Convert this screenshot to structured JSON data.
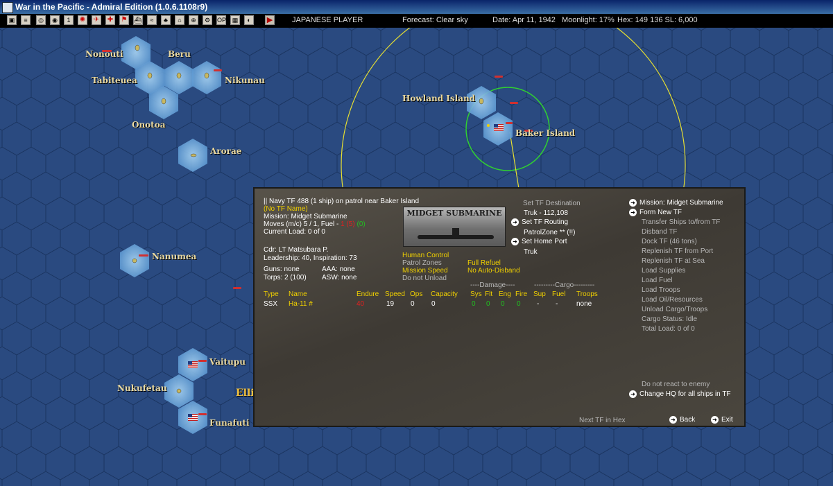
{
  "window": {
    "title": "War in the Pacific - Admiral Edition (1.0.6.1108r9)"
  },
  "toolbar": {
    "player": "JAPANESE PLAYER",
    "forecast": "Forecast: Clear sky",
    "date": "Date: Apr 11, 1942",
    "moonlight": "Moonlight: 17%",
    "hex": "Hex: 149 136  SL: 6,000"
  },
  "map": {
    "labels": {
      "nonouti": "Nonouti",
      "beru": "Beru",
      "tabiteuea": "Tabiteuea",
      "nikunau": "Nikunau",
      "onotoa": "Onotoa",
      "arorae": "Arorae",
      "howland": "Howland Island",
      "baker": "Baker Island",
      "nanumea": "Nanumea",
      "vaitupu": "Vaitupu",
      "nukufetau": "Nukufetau",
      "funafuti": "Funafuti",
      "ellice_partial": "Elli"
    }
  },
  "tf": {
    "header": "|| Navy TF 488 (1 ship)  on patrol near Baker Island",
    "name": "(No TF Name)",
    "mission": "Mission: Midget Submarine",
    "moves_prefix": "Moves (m/c) 5 / 1, Fuel - ",
    "moves_fuel": "1 (5)",
    "moves_fuel2": "(0)",
    "current_load": "Current Load: 0 of 0",
    "commander": "Cdr: LT Matsubara P.",
    "leadership": "Leadership: 40, Inspiration: 73",
    "guns": "Guns: none",
    "aaa": "AAA: none",
    "torps": "Torps: 2 (100)",
    "asw": "ASW: none",
    "photo_caption": "MIDGET SUBMARINE",
    "opt1": "Human Control",
    "opt2": "Patrol Zones",
    "opt3": "Mission Speed",
    "opt4": "Do not Unload",
    "opt5": "Full Refuel",
    "opt6": "No Auto-Disband"
  },
  "orders": {
    "set_destination": "Set TF Destination",
    "destination": "Truk - 112,108",
    "set_routing": "Set TF Routing",
    "patrol_zone": "PatrolZone ** (!!)",
    "set_home": "Set Home Port",
    "home": "Truk"
  },
  "table": {
    "headers": {
      "type": "Type",
      "name": "Name",
      "endure": "Endure",
      "speed": "Speed",
      "ops": "Ops",
      "capacity": "Capacity"
    },
    "damage_group": "----Damage----",
    "cargo_group": "---------Cargo---------",
    "subheaders": {
      "sys": "Sys",
      "flt": "Flt",
      "eng": "Eng",
      "fire": "Fire",
      "sup": "Sup",
      "fuel": "Fuel",
      "troops": "Troops"
    },
    "row": {
      "type": "SSX",
      "name": "Ha-11 #",
      "endure": "40",
      "speed": "19",
      "ops": "0",
      "capacity": "0",
      "sys": "0",
      "flt": "0",
      "eng": "0",
      "fire": "0",
      "sup": "-",
      "fuel": "-",
      "troops": "none"
    }
  },
  "menu": {
    "mission": "Mission: Midget Submarine",
    "form_new": "Form New TF",
    "transfer": "Transfer Ships to/from TF",
    "disband": "Disband TF",
    "dock": "Dock TF (46 tons)",
    "replenish_port": "Replenish TF from Port",
    "replenish_sea": "Replenish TF at Sea",
    "load_supplies": "Load Supplies",
    "load_fuel": "Load Fuel",
    "load_troops": "Load Troops",
    "load_oil": "Load Oil/Resources",
    "unload": "Unload Cargo/Troops",
    "cargo_status": "Cargo Status: Idle",
    "total_load": "Total Load: 0 of 0",
    "no_react": "Do not react to enemy",
    "change_hq": "Change HQ for all ships in TF",
    "next_tf": "Next TF in Hex",
    "back": "Back",
    "exit": "Exit"
  },
  "colors": {
    "ocean": "#2a4a80",
    "hex_line": "#1a3460",
    "island_hex": "#7ab8e8",
    "text_yellow": "#f0d000",
    "text_green": "#20c020",
    "text_red": "#e02020"
  }
}
